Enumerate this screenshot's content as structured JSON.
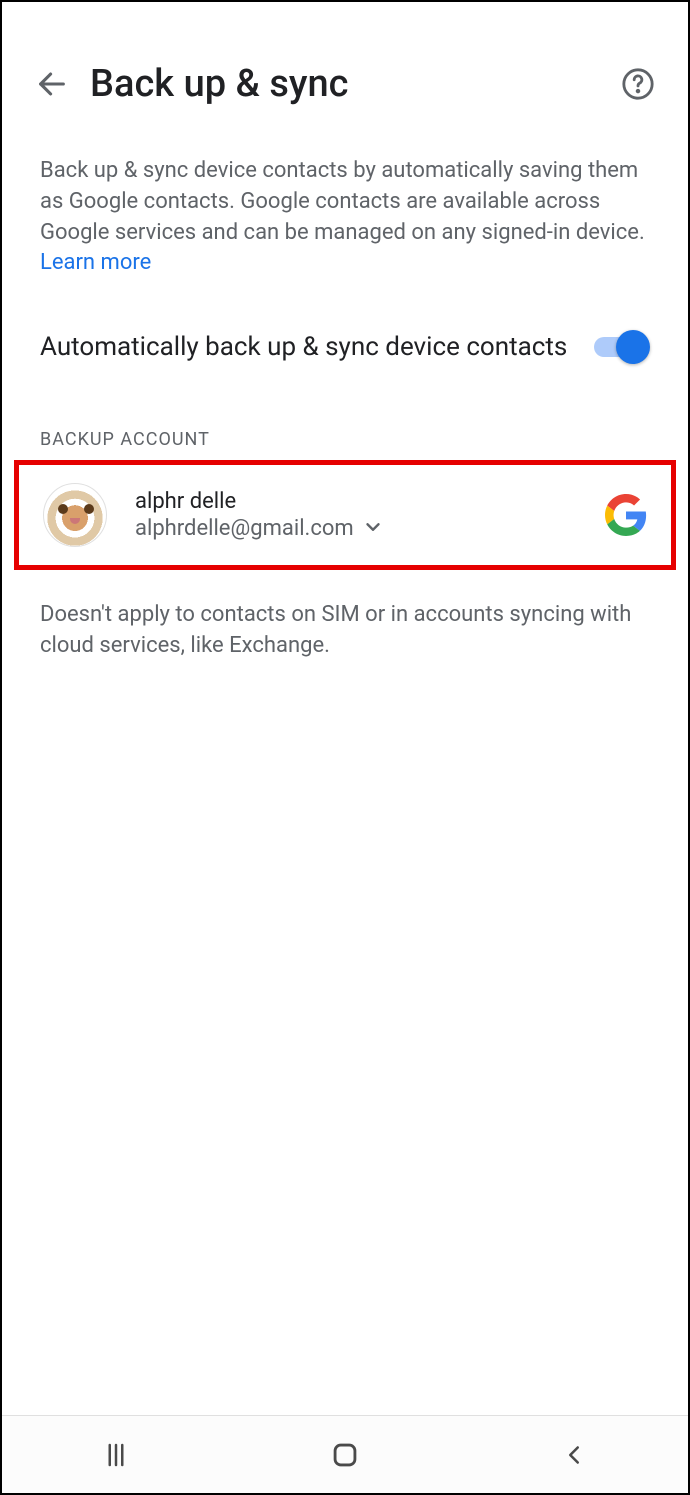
{
  "header": {
    "title": "Back up & sync"
  },
  "description": {
    "text": "Back up & sync device contacts by automatically saving them as Google contacts. Google contacts are available across Google services and can be managed on any signed-in device. ",
    "learn_more": "Learn more"
  },
  "toggle": {
    "label": "Automatically back up & sync device contacts",
    "enabled": true
  },
  "section_label": "BACKUP ACCOUNT",
  "account": {
    "name": "alphr delle",
    "email": "alphrdelle@gmail.com",
    "provider": "google"
  },
  "footnote": "Doesn't apply to contacts on SIM or in accounts syncing with cloud services, like Exchange.",
  "colors": {
    "accent": "#1a73e8",
    "highlight_border": "#e60000"
  }
}
